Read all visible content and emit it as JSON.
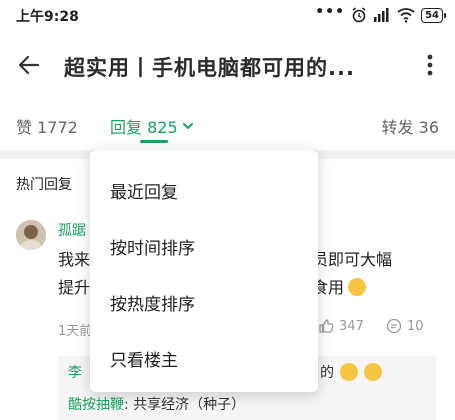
{
  "status_bar": {
    "time": "上午9:28",
    "battery": "54"
  },
  "header": {
    "title": "超实用丨手机电脑都可用的..."
  },
  "tabs": {
    "like": "赞 1772",
    "reply": "回复 825",
    "repost": "转发 36"
  },
  "section": {
    "hot_label": "热门回复"
  },
  "comment": {
    "author": "孤踞",
    "line1_start": "我来",
    "line1_end": "会员即可大幅",
    "line2_start": "提升",
    "line2_end": "食用",
    "time": "1天前",
    "likes": "347",
    "replies": "10"
  },
  "subreply": {
    "line1_name": "李",
    "line1_tail": "的",
    "line2_user": "酷按抽鞭",
    "line2_text": ": 共享经济（种子）"
  },
  "dropdown": {
    "items": [
      "最近回复",
      "按时间排序",
      "按热度排序",
      "只看楼主"
    ]
  },
  "colors": {
    "accent": "#1aa260"
  }
}
